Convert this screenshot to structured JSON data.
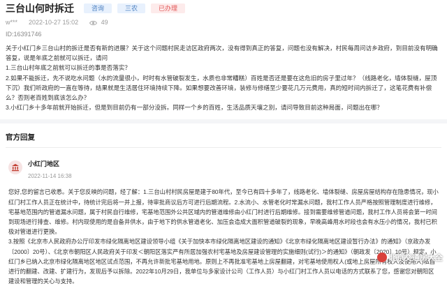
{
  "header": {
    "title": "三台山何时拆迁",
    "tags": [
      "咨询",
      "三农",
      "已办理"
    ]
  },
  "meta": {
    "user": "w***",
    "date": "2022-10-27 15:02",
    "views": "49"
  },
  "id_text": "ID:16391746",
  "question": {
    "lines": [
      "关于小红门乡三台山村的拆迁是否有新的进展？关于这个问题村民走访区政府两次，没有得到真正的答复，问题也没有解决，村民每周问访乡政府，到目前没有明确答复，说是年底之前就可以拆迁，请问",
      "1.三台山村年底之前就可以拆迁的事是否落实？",
      "2.如果不能拆迁，先不说吃水问题（水的流量很小，时时有水管破裂发生，水质也非常糟糕）百姓是否还是要在这危旧的房子里过年？（线路老化，墙体裂缝，屋顶下沉）我们听政府的一直在等待，结果就是生活居住环境持续下降。如果想要改善环境，装修与修缮至少要花几万元费用，真的短时间内拆迁了，这笔花费有补偿么？否则老百姓到底该怎么办？",
      "3.小红门乡十多年前就开始拆迁，但是到目前仍有一部分没拆。同样一个乡的百姓，生活品质天壤之别，请问导致目前这种局面，问题出在哪？"
    ]
  },
  "reply_section": {
    "title": "官方回复",
    "org_name": "小红门地区",
    "org_date": "2022-11-14 16:38",
    "lines": [
      "您好,您的留言已收悉。关于您反映的问题，经了解：1.三台山村村民房屋是建于80年代，至今已有四十多年了，线路老化、墙体裂缝、房屋房屋结构存在隐患情况，现小红门村工作人员正在统计中，待统计完后将一并上报，待审批商议后方可进行后期流程。2.水流小、水管老化时常漏水问题，我村工作人员严格按照管理制度进行维修，宅基地范围内的管道漏水问题，属于村民自行维修，宅基地范围外公共区域内的管道维修由小红门村进行后期维修。接到需要维修管道问题，我村工作人员将会第一时间到现场进行排查、维修。村内现使用的是自备井供水，由于地下的供水管道老化、加压会造成大面积管道破裂的现象，早晚高峰用水时段也会有水压小的情况，我村已积极对管道进行更换。",
      "3.按照《北京市人民政府办公厅印发市绿化隔离地区建设领导小组《关于加快本市绿化隔离地区建设的通知》《北京市绿化隔离地区建设暂行办法》的通知》（京政办发〔2000〕20号）、《北京市朝阳区人民政府关于印发＜朝阳区落实严有所居加强农村宅基地及房屋建设管理的实施细则(试行)＞的通知》（朝政发〔2020〕10号）规定，小红门乡已纳入北京市绿化隔离地区地区试点范围，不再允许新批宅基地用地。原则上不再批准宅基地上房屋翻建，对宅基地使用权人(或地上房屋所有权人及使用人)私自进行的翻建、改建、扩建行为，发现后予以拆除。2022年10月29日，我单位与多家设计公司（工作人员）与小红门村工作人员以电话的方式联系了您，感谢您对朝阳区建设和管理的关心与支持。"
    ]
  },
  "watermark": "北京交通房大全",
  "colors": {
    "tag_blue_bg": "#e8f1fd",
    "tag_blue_text": "#4a7fc1",
    "tag_red_bg": "#fdebeb",
    "tag_red_text": "#e25757",
    "org_icon": "#c0392b"
  }
}
